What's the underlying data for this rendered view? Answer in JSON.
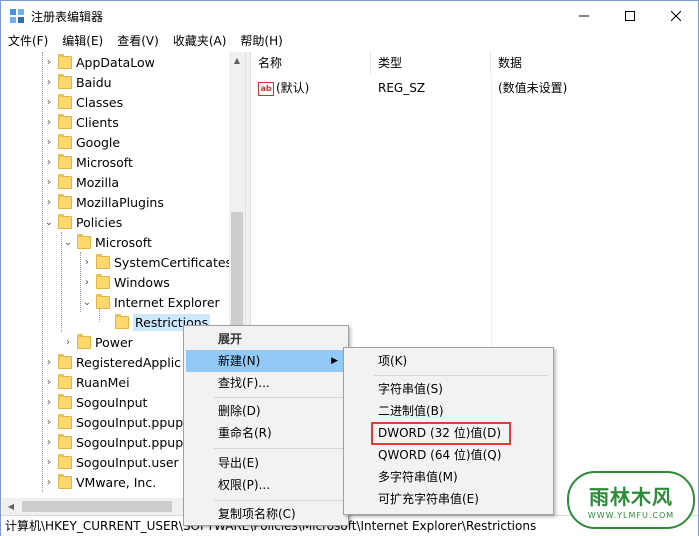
{
  "window": {
    "title": "注册表编辑器"
  },
  "menubar": [
    "文件(F)",
    "编辑(E)",
    "查看(V)",
    "收藏夹(A)",
    "帮助(H)"
  ],
  "tree": {
    "items": [
      {
        "label": "AppDataLow",
        "twisty": "right"
      },
      {
        "label": "Baidu",
        "twisty": "right"
      },
      {
        "label": "Classes",
        "twisty": "right"
      },
      {
        "label": "Clients",
        "twisty": "right"
      },
      {
        "label": "Google",
        "twisty": "right"
      },
      {
        "label": "Microsoft",
        "twisty": "right"
      },
      {
        "label": "Mozilla",
        "twisty": "right"
      },
      {
        "label": "MozillaPlugins",
        "twisty": "right"
      },
      {
        "label": "Policies",
        "twisty": "down"
      },
      {
        "label": "Microsoft",
        "twisty": "down"
      },
      {
        "label": "SystemCertificates",
        "twisty": "right"
      },
      {
        "label": "Windows",
        "twisty": "right"
      },
      {
        "label": "Internet Explorer",
        "twisty": "down"
      },
      {
        "label": "Restrictions",
        "twisty": "none",
        "selected": true
      },
      {
        "label": "Power",
        "twisty": "right"
      },
      {
        "label": "RegisteredApplic",
        "twisty": "right"
      },
      {
        "label": "RuanMei",
        "twisty": "right"
      },
      {
        "label": "SogouInput",
        "twisty": "right"
      },
      {
        "label": "SogouInput.ppup",
        "twisty": "right"
      },
      {
        "label": "SogouInput.ppup",
        "twisty": "right"
      },
      {
        "label": "SogouInput.user",
        "twisty": "right"
      },
      {
        "label": "VMware, Inc.",
        "twisty": "right"
      }
    ]
  },
  "list": {
    "headers": {
      "name": "名称",
      "type": "类型",
      "data": "数据"
    },
    "rows": [
      {
        "icon": "ab",
        "name": "(默认)",
        "type": "REG_SZ",
        "data": "(数值未设置)"
      }
    ]
  },
  "statusbar": {
    "path": "计算机\\HKEY_CURRENT_USER\\SOFTWARE\\Policies\\Microsoft\\Internet Explorer\\Restrictions"
  },
  "context_menu": {
    "items": [
      "展开",
      "新建(N)",
      "查找(F)...",
      "删除(D)",
      "重命名(R)",
      "导出(E)",
      "权限(P)...",
      "复制项名称(C)"
    ]
  },
  "submenu": {
    "items": [
      "项(K)",
      "字符串值(S)",
      "二进制值(B)",
      "DWORD (32 位)值(D)",
      "QWORD (64 位)值(Q)",
      "多字符串值(M)",
      "可扩充字符串值(E)"
    ]
  },
  "watermark": {
    "title": "雨林木风",
    "url": "WWW.YLMFU.COM"
  },
  "colors": {
    "accent": "#91c9f7",
    "selection": "#cce8ff",
    "highlight_border": "#e53935",
    "folder": "#ffd86b"
  }
}
